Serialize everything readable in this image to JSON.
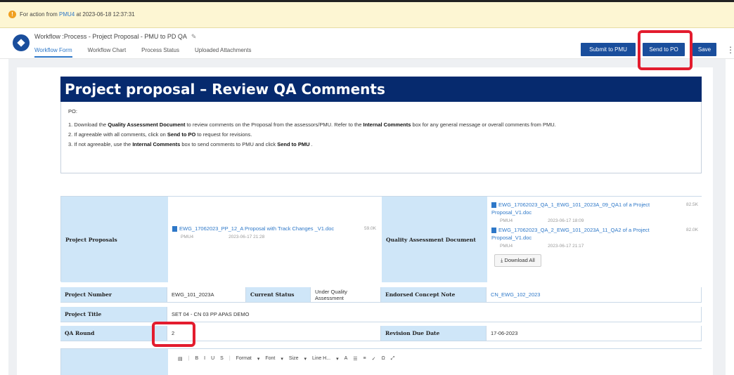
{
  "notice": {
    "prefix": "For action from",
    "actor": "PMU4",
    "suffix": "at 2023-06-18 12:37:31",
    "icon": "warning-icon"
  },
  "header": {
    "title": "Workflow :Process - Project Proposal - PMU to PD QA",
    "tabs": [
      "Workflow Form",
      "Workflow Chart",
      "Process Status",
      "Uploaded Attachments"
    ],
    "active_tab": "Workflow Form"
  },
  "toolbar": {
    "submit_pmu": "Submit to PMU",
    "send_po": "Send to PO",
    "save": "Save"
  },
  "banner": {
    "title": "Project proposal – Review QA Comments"
  },
  "instructions": {
    "greeting": "PO:",
    "step1_a": "1. Download the ",
    "step1_b": "Quality Assessment Document",
    "step1_c": " to review comments on the Proposal from the assessors/PMU. Refer to the ",
    "step1_d": "Internal Comments",
    "step1_e": " box for any general message or overall comments from PMU.",
    "step2_a": "2. If agreeable with all comments, click on ",
    "step2_b": "Send to PO",
    "step2_c": " to request for revisions.",
    "step3_a": "3. If not agreeable, use the ",
    "step3_b": "Internal Comments",
    "step3_c": " box to send comments to PMU and click ",
    "step3_d": "Send to PMU",
    "step3_e": " ."
  },
  "proposals": {
    "label": "Project Proposals",
    "file": {
      "name": "EWG_17062023_PP_12_A Proposal with Track Changes _V1.doc",
      "size": "59.0K",
      "by": "PMU4",
      "date": "2023-06-17 21:28"
    }
  },
  "qa_doc": {
    "label": "Quality Assessment Document",
    "files": [
      {
        "name": "EWG_17062023_QA_1_EWG_101_2023A_09_QA1 of a Project Proposal_V1.doc",
        "size": "82.5K",
        "by": "PMU4",
        "date": "2023-06-17 18:09"
      },
      {
        "name": "EWG_17062023_QA_2_EWG_101_2023A_11_QA2 of a Project Proposal_V1.doc",
        "size": "82.0K",
        "by": "PMU4",
        "date": "2023-06-17 21:17"
      }
    ],
    "download_all": "Download All"
  },
  "fields": {
    "project_number_label": "Project Number",
    "project_number": "EWG_101_2023A",
    "current_status_label": "Current Status",
    "current_status": "Under Quality Assessment",
    "endorsed_label": "Endorsed Concept Note",
    "endorsed": "CN_EWG_102_2023",
    "project_title_label": "Project Title",
    "project_title": "SET 04 - CN 03 PP APAS DEMO",
    "qa_round_label": "QA Round",
    "qa_round": "2",
    "revision_label": "Revision Due Date",
    "revision": "17-06-2023"
  },
  "editor_toolbar": [
    "B",
    "I",
    "U",
    "S",
    "Format",
    "Font",
    "Size",
    "Line H...",
    "A",
    "☰",
    "≡",
    "✓",
    "Ω"
  ]
}
